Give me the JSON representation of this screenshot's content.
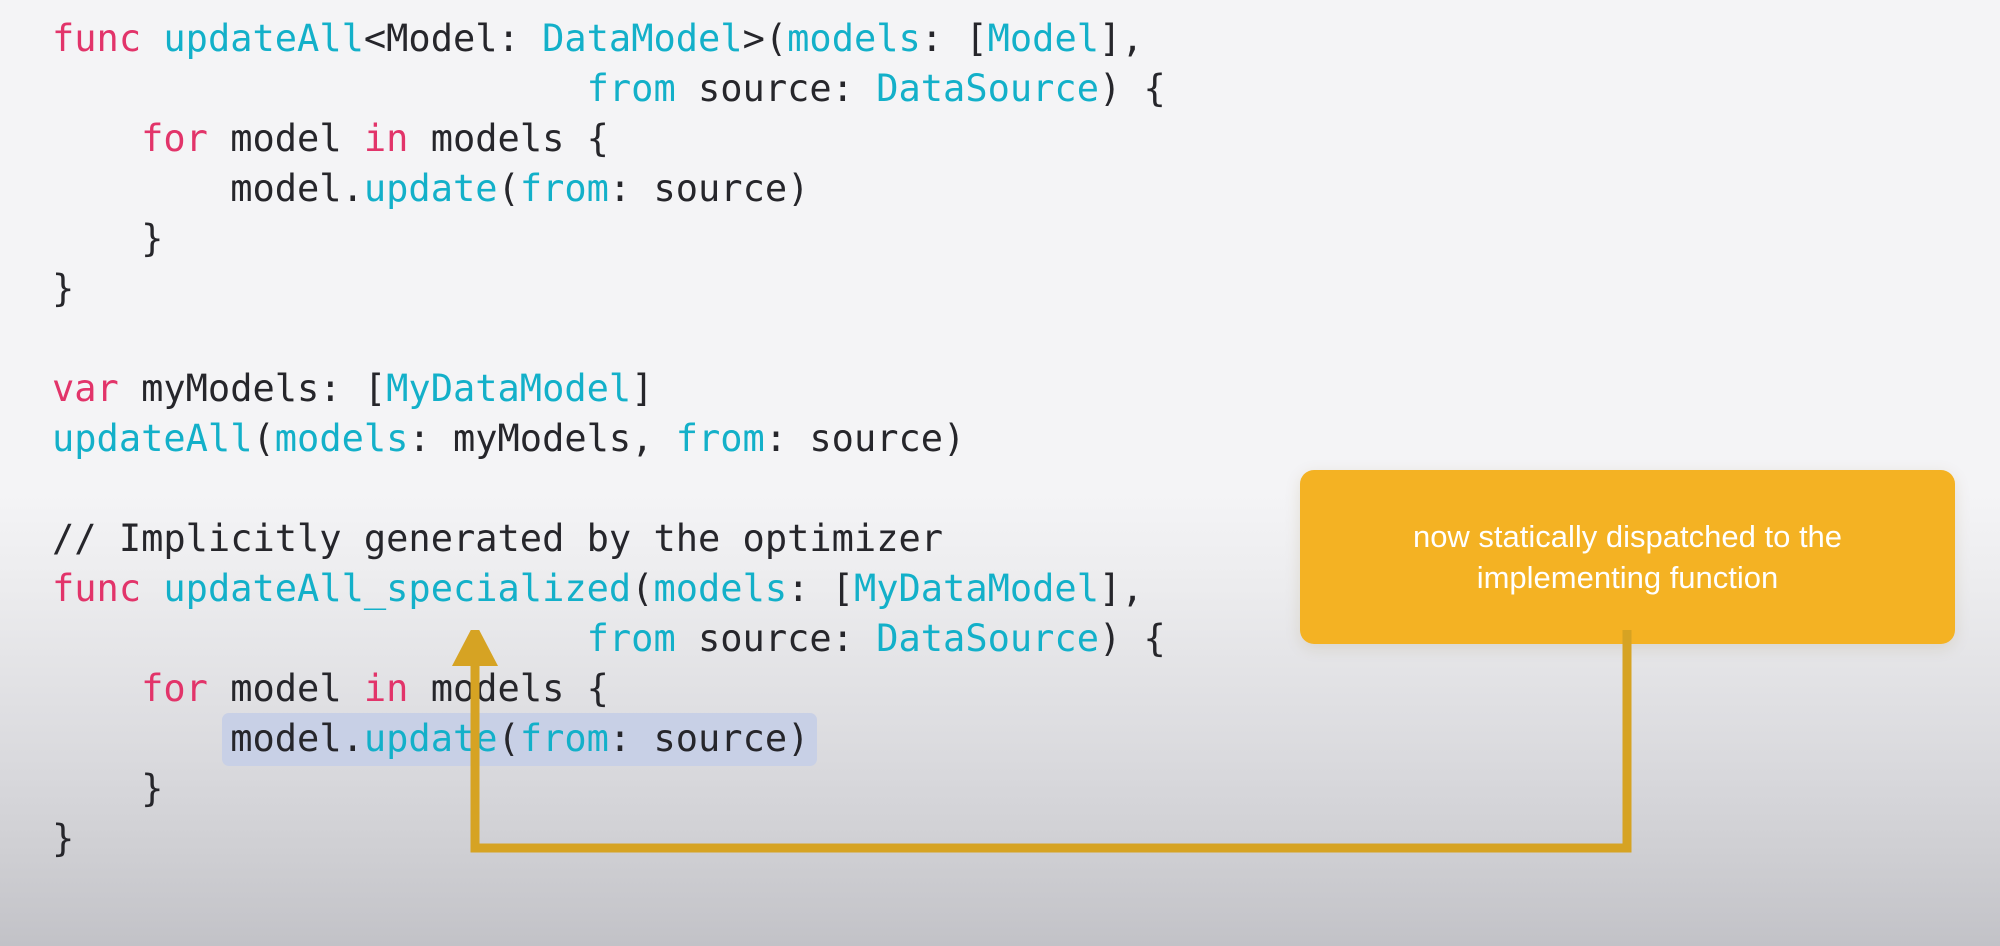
{
  "theme": {
    "background_top": "#f4f4f6",
    "background_bottom": "#c2c2c7",
    "keyword_color": "#e2346a",
    "identifier_color": "#13b0c9",
    "text_color": "#26262b",
    "highlight_background": "#c8d0e6",
    "callout_background": "#f4b223",
    "callout_text_color": "#ffffff",
    "connector_color": "#d6a323"
  },
  "code": {
    "language": "swift",
    "lines": [
      {
        "id": "line-1",
        "tokens": [
          {
            "t": "func",
            "c": "kw"
          },
          {
            "t": " ",
            "c": "plain"
          },
          {
            "t": "updateAll",
            "c": "fn"
          },
          {
            "t": "<Model: ",
            "c": "plain"
          },
          {
            "t": "DataModel",
            "c": "type"
          },
          {
            "t": ">(",
            "c": "plain"
          },
          {
            "t": "models",
            "c": "fn"
          },
          {
            "t": ": [",
            "c": "plain"
          },
          {
            "t": "Model",
            "c": "type"
          },
          {
            "t": "],",
            "c": "plain"
          }
        ]
      },
      {
        "id": "line-2",
        "tokens": [
          {
            "t": "                        ",
            "c": "plain"
          },
          {
            "t": "from",
            "c": "fn"
          },
          {
            "t": " source: ",
            "c": "plain"
          },
          {
            "t": "DataSource",
            "c": "type"
          },
          {
            "t": ") {",
            "c": "plain"
          }
        ]
      },
      {
        "id": "line-3",
        "tokens": [
          {
            "t": "    ",
            "c": "plain"
          },
          {
            "t": "for",
            "c": "kw"
          },
          {
            "t": " model ",
            "c": "plain"
          },
          {
            "t": "in",
            "c": "kw"
          },
          {
            "t": " models {",
            "c": "plain"
          }
        ]
      },
      {
        "id": "line-4",
        "tokens": [
          {
            "t": "        model.",
            "c": "plain"
          },
          {
            "t": "update",
            "c": "fn"
          },
          {
            "t": "(",
            "c": "plain"
          },
          {
            "t": "from",
            "c": "fn"
          },
          {
            "t": ": source)",
            "c": "plain"
          }
        ]
      },
      {
        "id": "line-5",
        "tokens": [
          {
            "t": "    }",
            "c": "plain"
          }
        ]
      },
      {
        "id": "line-6",
        "tokens": [
          {
            "t": "}",
            "c": "plain"
          }
        ]
      },
      {
        "id": "line-7",
        "tokens": [
          {
            "t": " ",
            "c": "plain"
          }
        ]
      },
      {
        "id": "line-8",
        "tokens": [
          {
            "t": "var",
            "c": "kw"
          },
          {
            "t": " myModels: [",
            "c": "plain"
          },
          {
            "t": "MyDataModel",
            "c": "type"
          },
          {
            "t": "]",
            "c": "plain"
          }
        ]
      },
      {
        "id": "line-9",
        "tokens": [
          {
            "t": "updateAll",
            "c": "fn"
          },
          {
            "t": "(",
            "c": "plain"
          },
          {
            "t": "models",
            "c": "fn"
          },
          {
            "t": ": myModels, ",
            "c": "plain"
          },
          {
            "t": "from",
            "c": "fn"
          },
          {
            "t": ": source)",
            "c": "plain"
          }
        ]
      },
      {
        "id": "line-10",
        "tokens": [
          {
            "t": " ",
            "c": "plain"
          }
        ]
      },
      {
        "id": "line-11",
        "tokens": [
          {
            "t": "// Implicitly generated by the optimizer",
            "c": "cmt"
          }
        ]
      },
      {
        "id": "line-12",
        "tokens": [
          {
            "t": "func",
            "c": "kw"
          },
          {
            "t": " ",
            "c": "plain"
          },
          {
            "t": "updateAll_specialized",
            "c": "fn"
          },
          {
            "t": "(",
            "c": "plain"
          },
          {
            "t": "models",
            "c": "fn"
          },
          {
            "t": ": [",
            "c": "plain"
          },
          {
            "t": "MyDataModel",
            "c": "type"
          },
          {
            "t": "],",
            "c": "plain"
          }
        ]
      },
      {
        "id": "line-13",
        "tokens": [
          {
            "t": "                        ",
            "c": "plain"
          },
          {
            "t": "from",
            "c": "fn"
          },
          {
            "t": " source: ",
            "c": "plain"
          },
          {
            "t": "DataSource",
            "c": "type"
          },
          {
            "t": ") {",
            "c": "plain"
          }
        ]
      },
      {
        "id": "line-14",
        "tokens": [
          {
            "t": "    ",
            "c": "plain"
          },
          {
            "t": "for",
            "c": "kw"
          },
          {
            "t": " model ",
            "c": "plain"
          },
          {
            "t": "in",
            "c": "kw"
          },
          {
            "t": " models {",
            "c": "plain"
          }
        ]
      },
      {
        "id": "line-15",
        "highlighted": true,
        "indent": "        ",
        "tokens": [
          {
            "t": "model.",
            "c": "plain"
          },
          {
            "t": "update",
            "c": "fn"
          },
          {
            "t": "(",
            "c": "plain"
          },
          {
            "t": "from",
            "c": "fn"
          },
          {
            "t": ": source)",
            "c": "plain"
          }
        ]
      },
      {
        "id": "line-16",
        "tokens": [
          {
            "t": "    }",
            "c": "plain"
          }
        ]
      },
      {
        "id": "line-17",
        "tokens": [
          {
            "t": "}",
            "c": "plain"
          }
        ]
      }
    ]
  },
  "callout": {
    "text": "now statically dispatched to the\nimplementing function"
  }
}
